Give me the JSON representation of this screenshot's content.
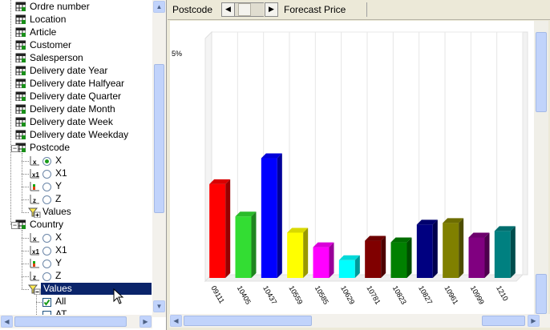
{
  "tree": {
    "items": [
      {
        "label": "Ordre number"
      },
      {
        "label": "Location"
      },
      {
        "label": "Article"
      },
      {
        "label": "Customer"
      },
      {
        "label": "Salesperson"
      },
      {
        "label": "Delivery date Year"
      },
      {
        "label": "Delivery date Halfyear"
      },
      {
        "label": "Delivery date Quarter"
      },
      {
        "label": "Delivery date Month"
      },
      {
        "label": "Delivery date Week"
      },
      {
        "label": "Delivery date Weekday"
      }
    ],
    "postcode": {
      "label": "Postcode",
      "axes": [
        {
          "label": "X",
          "selected": true
        },
        {
          "label": "X1",
          "selected": false
        },
        {
          "label": "Y",
          "selected": false
        },
        {
          "label": "Z",
          "selected": false
        }
      ],
      "values_label": "Values"
    },
    "country": {
      "label": "Country",
      "axes": [
        {
          "label": "X",
          "selected": false
        },
        {
          "label": "X1",
          "selected": false
        },
        {
          "label": "Y",
          "selected": false
        },
        {
          "label": "Z",
          "selected": false
        }
      ],
      "values_label": "Values",
      "value_items": [
        {
          "label": "All",
          "checked": true
        },
        {
          "label": "AT",
          "checked": false
        }
      ]
    }
  },
  "topbar": {
    "dimension_label": "Postcode",
    "measure_label": "Forecast Price"
  },
  "chart_data": {
    "type": "bar",
    "y_tick_label": "5%",
    "categories": [
      "09111",
      "10405",
      "10437",
      "10559",
      "10585",
      "10629",
      "10781",
      "10823",
      "10827",
      "10961",
      "10999",
      "1210"
    ],
    "values": [
      0.58,
      0.38,
      0.74,
      0.28,
      0.19,
      0.11,
      0.23,
      0.22,
      0.33,
      0.34,
      0.25,
      0.29
    ],
    "colors": [
      "#ff0000",
      "#33dd33",
      "#0000ff",
      "#ffff00",
      "#ff00ff",
      "#00ffff",
      "#800000",
      "#008000",
      "#000080",
      "#808000",
      "#800080",
      "#008080"
    ],
    "ylim": [
      0,
      1.5
    ]
  }
}
